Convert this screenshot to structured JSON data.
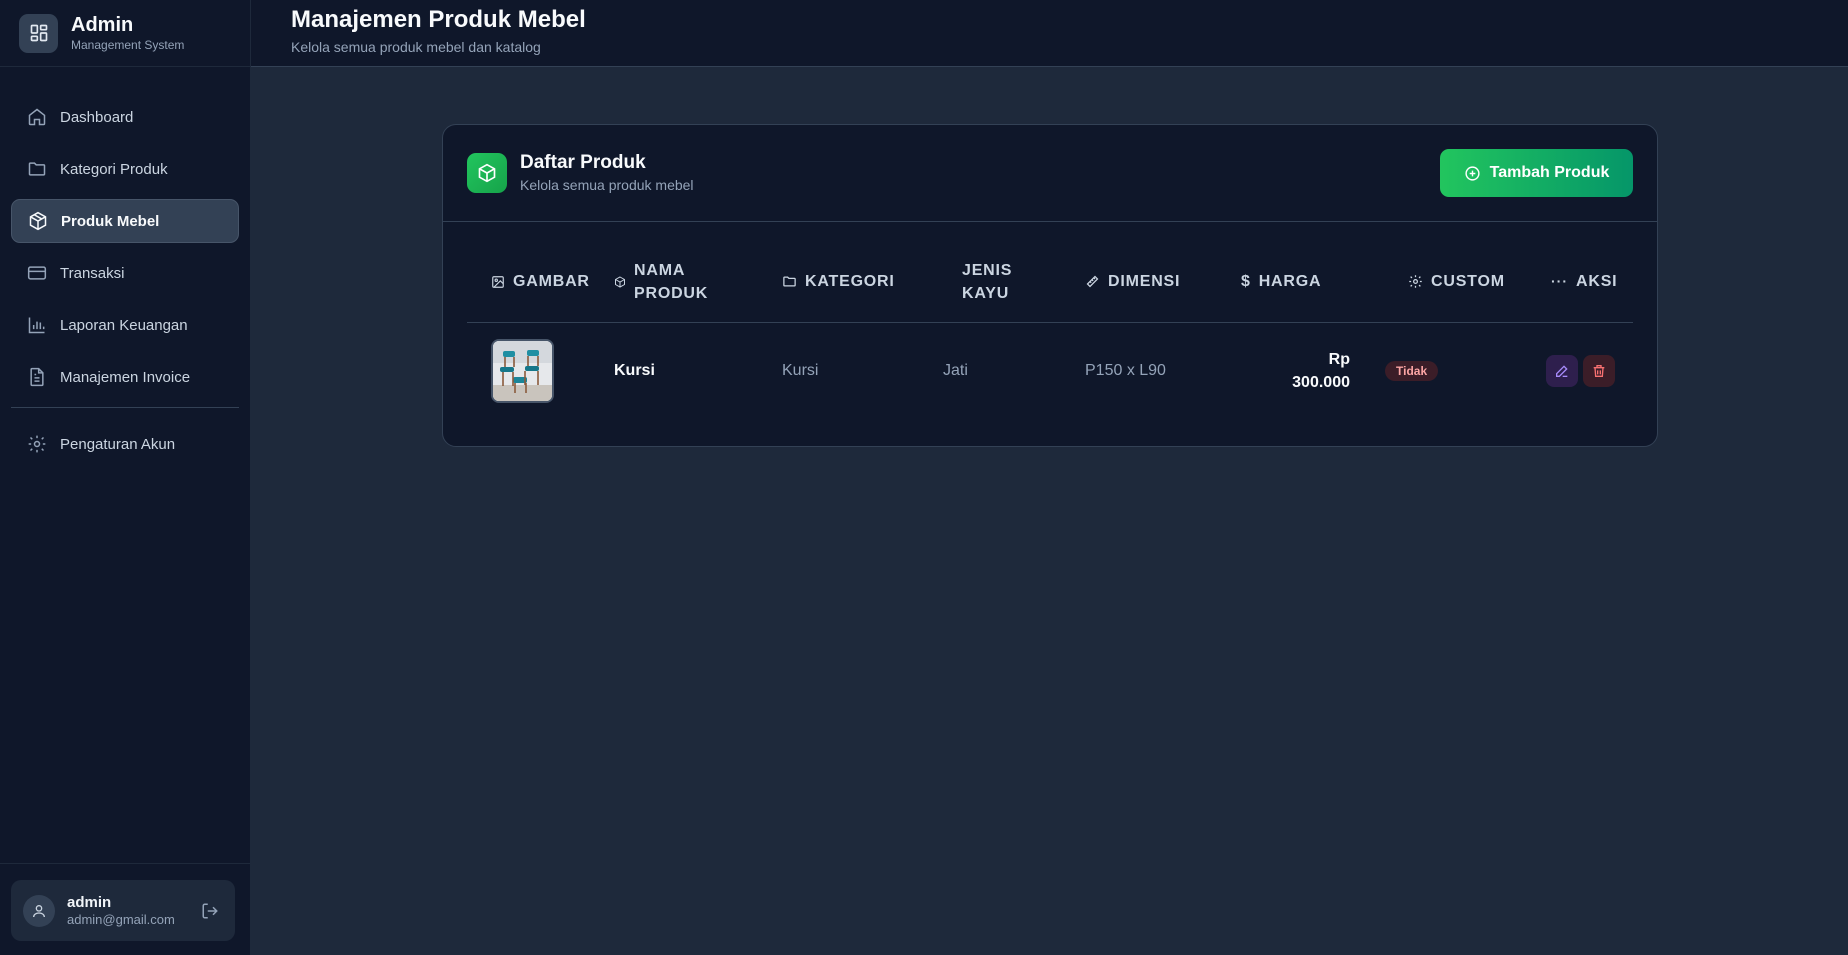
{
  "sidebar": {
    "brand": {
      "title": "Admin",
      "subtitle": "Management System"
    },
    "items": [
      {
        "label": "Dashboard",
        "icon": "home-icon",
        "active": false
      },
      {
        "label": "Kategori Produk",
        "icon": "folder-icon",
        "active": false
      },
      {
        "label": "Produk Mebel",
        "icon": "box-icon",
        "active": true
      },
      {
        "label": "Transaksi",
        "icon": "credit-card-icon",
        "active": false
      },
      {
        "label": "Laporan Keuangan",
        "icon": "bar-chart-icon",
        "active": false
      },
      {
        "label": "Manajemen Invoice",
        "icon": "file-text-icon",
        "active": false
      },
      {
        "label": "Pengaturan Akun",
        "icon": "gear-icon",
        "active": false
      }
    ],
    "user": {
      "name": "admin",
      "email": "admin@gmail.com"
    }
  },
  "header": {
    "title": "Manajemen Produk Mebel",
    "subtitle": "Kelola semua produk mebel dan katalog"
  },
  "card": {
    "title": "Daftar Produk",
    "subtitle": "Kelola semua produk mebel",
    "add_button": "Tambah Produk"
  },
  "table": {
    "columns": {
      "gambar": "Gambar",
      "nama_produk": "Nama Produk",
      "kategori": "Kategori",
      "jenis_kayu": "Jenis Kayu",
      "dimensi": "Dimensi",
      "harga": "Harga",
      "custom": "Custom",
      "aksi": "Aksi"
    },
    "rows": [
      {
        "nama": "Kursi",
        "kategori": "Kursi",
        "jenis_kayu": "Jati",
        "dimensi": "P150 x L90",
        "harga_prefix": "Rp",
        "harga": "300.000",
        "custom": "Tidak"
      }
    ]
  },
  "colors": {
    "background": "#1e293b",
    "sidebar": "#0f172a",
    "accent": "#22c55e",
    "danger": "#f87171",
    "edit": "#a78bfa"
  }
}
